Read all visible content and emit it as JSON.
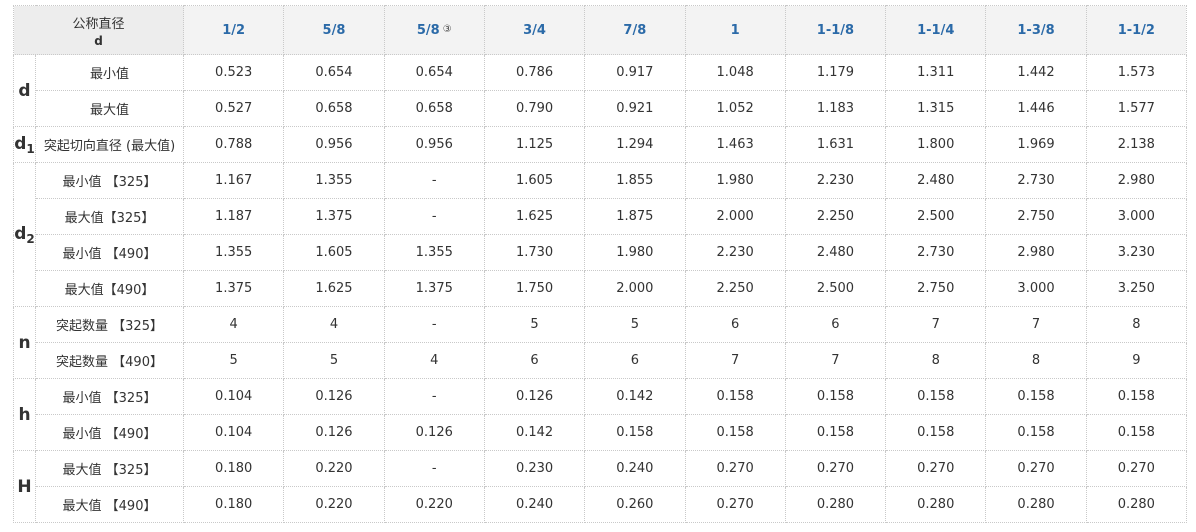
{
  "header": {
    "corner_line1": "公称直径",
    "corner_line2": "d",
    "columns": [
      "1/2",
      "5/8",
      "5/8",
      "3/4",
      "7/8",
      "1",
      "1-1/8",
      "1-1/4",
      "1-3/8",
      "1-1/2"
    ],
    "column_note": "③"
  },
  "groups": [
    {
      "symbol": "d",
      "subscript": "",
      "rows": [
        {
          "label": "最小值",
          "values": [
            "0.523",
            "0.654",
            "0.654",
            "0.786",
            "0.917",
            "1.048",
            "1.179",
            "1.311",
            "1.442",
            "1.573"
          ]
        },
        {
          "label": "最大值",
          "values": [
            "0.527",
            "0.658",
            "0.658",
            "0.790",
            "0.921",
            "1.052",
            "1.183",
            "1.315",
            "1.446",
            "1.577"
          ]
        }
      ]
    },
    {
      "symbol": "d",
      "subscript": "1",
      "rows": [
        {
          "label": "突起切向直径 (最大值)",
          "values": [
            "0.788",
            "0.956",
            "0.956",
            "1.125",
            "1.294",
            "1.463",
            "1.631",
            "1.800",
            "1.969",
            "2.138"
          ]
        }
      ]
    },
    {
      "symbol": "d",
      "subscript": "2",
      "rows": [
        {
          "label": "最小值 【325】",
          "values": [
            "1.167",
            "1.355",
            "-",
            "1.605",
            "1.855",
            "1.980",
            "2.230",
            "2.480",
            "2.730",
            "2.980"
          ]
        },
        {
          "label": "最大值【325】",
          "values": [
            "1.187",
            "1.375",
            "-",
            "1.625",
            "1.875",
            "2.000",
            "2.250",
            "2.500",
            "2.750",
            "3.000"
          ]
        },
        {
          "label": "最小值 【490】",
          "values": [
            "1.355",
            "1.605",
            "1.355",
            "1.730",
            "1.980",
            "2.230",
            "2.480",
            "2.730",
            "2.980",
            "3.230"
          ]
        },
        {
          "label": "最大值【490】",
          "values": [
            "1.375",
            "1.625",
            "1.375",
            "1.750",
            "2.000",
            "2.250",
            "2.500",
            "2.750",
            "3.000",
            "3.250"
          ]
        }
      ]
    },
    {
      "symbol": "n",
      "subscript": "",
      "rows": [
        {
          "label": "突起数量 【325】",
          "values": [
            "4",
            "4",
            "-",
            "5",
            "5",
            "6",
            "6",
            "7",
            "7",
            "8"
          ]
        },
        {
          "label": "突起数量 【490】",
          "values": [
            "5",
            "5",
            "4",
            "6",
            "6",
            "7",
            "7",
            "8",
            "8",
            "9"
          ]
        }
      ]
    },
    {
      "symbol": "h",
      "subscript": "",
      "rows": [
        {
          "label": "最小值 【325】",
          "values": [
            "0.104",
            "0.126",
            "-",
            "0.126",
            "0.142",
            "0.158",
            "0.158",
            "0.158",
            "0.158",
            "0.158"
          ]
        },
        {
          "label": "最小值 【490】",
          "values": [
            "0.104",
            "0.126",
            "0.126",
            "0.142",
            "0.158",
            "0.158",
            "0.158",
            "0.158",
            "0.158",
            "0.158"
          ]
        }
      ]
    },
    {
      "symbol": "H",
      "subscript": "",
      "rows": [
        {
          "label": "最大值 【325】",
          "values": [
            "0.180",
            "0.220",
            "-",
            "0.230",
            "0.240",
            "0.270",
            "0.270",
            "0.270",
            "0.270",
            "0.270"
          ]
        },
        {
          "label": "最大值 【490】",
          "values": [
            "0.180",
            "0.220",
            "0.220",
            "0.240",
            "0.260",
            "0.270",
            "0.280",
            "0.280",
            "0.280",
            "0.280"
          ]
        }
      ]
    }
  ]
}
